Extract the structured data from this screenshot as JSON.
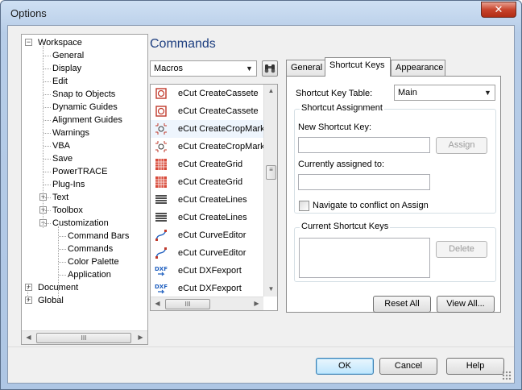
{
  "window": {
    "title": "Options",
    "close_glyph": "✕"
  },
  "tree": {
    "items": [
      {
        "label": "Workspace",
        "level": 0,
        "expander": "−"
      },
      {
        "label": "General",
        "level": 1
      },
      {
        "label": "Display",
        "level": 1
      },
      {
        "label": "Edit",
        "level": 1
      },
      {
        "label": "Snap to Objects",
        "level": 1
      },
      {
        "label": "Dynamic Guides",
        "level": 1
      },
      {
        "label": "Alignment Guides",
        "level": 1
      },
      {
        "label": "Warnings",
        "level": 1
      },
      {
        "label": "VBA",
        "level": 1
      },
      {
        "label": "Save",
        "level": 1
      },
      {
        "label": "PowerTRACE",
        "level": 1
      },
      {
        "label": "Plug-Ins",
        "level": 1
      },
      {
        "label": "Text",
        "level": 1,
        "expander": "+"
      },
      {
        "label": "Toolbox",
        "level": 1,
        "expander": "+"
      },
      {
        "label": "Customization",
        "level": 1,
        "expander": "−"
      },
      {
        "label": "Command Bars",
        "level": 2
      },
      {
        "label": "Commands",
        "level": 2
      },
      {
        "label": "Color Palette",
        "level": 2
      },
      {
        "label": "Application",
        "level": 2
      },
      {
        "label": "Document",
        "level": 0,
        "expander": "+"
      },
      {
        "label": "Global",
        "level": 0,
        "expander": "+"
      }
    ]
  },
  "commands": {
    "heading": "Commands",
    "category_value": "Macros",
    "items": [
      {
        "label": "eCut CreateCassete",
        "icon": "cassete-icon"
      },
      {
        "label": "eCut CreateCassete",
        "icon": "cassete-icon"
      },
      {
        "label": "eCut CreateCropMarks",
        "icon": "cropmarks-icon"
      },
      {
        "label": "eCut CreateCropMarks",
        "icon": "cropmarks-icon"
      },
      {
        "label": "eCut CreateGrid",
        "icon": "grid-icon"
      },
      {
        "label": "eCut CreateGrid",
        "icon": "grid-icon"
      },
      {
        "label": "eCut CreateLines",
        "icon": "lines-icon"
      },
      {
        "label": "eCut CreateLines",
        "icon": "lines-icon"
      },
      {
        "label": "eCut CurveEditor",
        "icon": "curve-editor-icon"
      },
      {
        "label": "eCut CurveEditor",
        "icon": "curve-editor-icon"
      },
      {
        "label": "eCut DXFexport",
        "icon": "dxf-export-icon"
      },
      {
        "label": "eCut DXFexport",
        "icon": "dxf-export-icon"
      }
    ],
    "dxf_text": "DXF"
  },
  "tabs": [
    {
      "label": "General"
    },
    {
      "label": "Shortcut Keys"
    },
    {
      "label": "Appearance"
    }
  ],
  "shortcut": {
    "table_label": "Shortcut Key Table:",
    "table_value": "Main",
    "assignment_title": "Shortcut Assignment",
    "new_key_label": "New Shortcut Key:",
    "assign_label": "Assign",
    "currently_label": "Currently assigned to:",
    "navigate_label": "Navigate to conflict on Assign",
    "current_title": "Current Shortcut Keys",
    "delete_label": "Delete",
    "reset_label": "Reset All",
    "view_label": "View All..."
  },
  "footer": {
    "ok": "OK",
    "cancel": "Cancel",
    "help": "Help"
  },
  "scroll_grip": "III"
}
